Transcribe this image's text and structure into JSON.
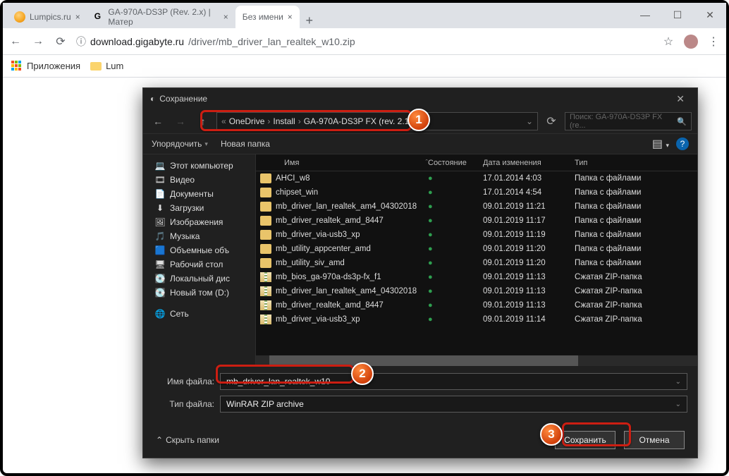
{
  "browser": {
    "tabs": [
      {
        "title": "Lumpics.ru"
      },
      {
        "title": "GA-970A-DS3P (Rev. 2.x) | Матер"
      },
      {
        "title": "Без имени"
      }
    ],
    "url_prefix": "download.gigabyte.ru",
    "url_path": "/driver/mb_driver_lan_realtek_w10.zip",
    "bookmarks_label": "Приложения",
    "bm_folder": "Lum"
  },
  "dialog": {
    "title": "Сохранение",
    "breadcrumb": [
      "OneDrive",
      "Install",
      "GA-970A-DS3P FX (rev. 2.1)"
    ],
    "search_placeholder": "Поиск: GA-970A-DS3P FX (re...",
    "toolbar": {
      "organize": "Упорядочить",
      "newfolder": "Новая папка"
    },
    "tree": [
      {
        "icon": "💻",
        "label": "Этот компьютер",
        "cls": "monitor-ic"
      },
      {
        "icon": "🎞",
        "label": "Видео"
      },
      {
        "icon": "📄",
        "label": "Документы"
      },
      {
        "icon": "⬇",
        "label": "Загрузки"
      },
      {
        "icon": "🖼",
        "label": "Изображения"
      },
      {
        "icon": "🎵",
        "label": "Музыка"
      },
      {
        "icon": "🟦",
        "label": "Объемные объ"
      },
      {
        "icon": "🖥",
        "label": "Рабочий стол"
      },
      {
        "icon": "💽",
        "label": "Локальный дис"
      },
      {
        "icon": "💽",
        "label": "Новый том (D:)"
      },
      {
        "icon": "",
        "label": ""
      },
      {
        "icon": "🌐",
        "label": "Сеть"
      }
    ],
    "columns": {
      "name": "Имя",
      "state": "Состояние",
      "date": "Дата изменения",
      "type": "Тип"
    },
    "files": [
      {
        "kind": "folder",
        "name": "AHCI_w8",
        "date": "17.01.2014 4:03",
        "type": "Папка с файлами"
      },
      {
        "kind": "folder",
        "name": "chipset_win",
        "date": "17.01.2014 4:54",
        "type": "Папка с файлами"
      },
      {
        "kind": "folder",
        "name": "mb_driver_lan_realtek_am4_04302018",
        "date": "09.01.2019 11:21",
        "type": "Папка с файлами"
      },
      {
        "kind": "folder",
        "name": "mb_driver_realtek_amd_8447",
        "date": "09.01.2019 11:17",
        "type": "Папка с файлами"
      },
      {
        "kind": "folder",
        "name": "mb_driver_via-usb3_xp",
        "date": "09.01.2019 11:19",
        "type": "Папка с файлами"
      },
      {
        "kind": "folder",
        "name": "mb_utility_appcenter_amd",
        "date": "09.01.2019 11:20",
        "type": "Папка с файлами"
      },
      {
        "kind": "folder",
        "name": "mb_utility_siv_amd",
        "date": "09.01.2019 11:20",
        "type": "Папка с файлами"
      },
      {
        "kind": "zip",
        "name": "mb_bios_ga-970a-ds3p-fx_f1",
        "date": "09.01.2019 11:13",
        "type": "Сжатая ZIP-папка"
      },
      {
        "kind": "zip",
        "name": "mb_driver_lan_realtek_am4_04302018",
        "date": "09.01.2019 11:13",
        "type": "Сжатая ZIP-папка"
      },
      {
        "kind": "zip",
        "name": "mb_driver_realtek_amd_8447",
        "date": "09.01.2019 11:13",
        "type": "Сжатая ZIP-папка"
      },
      {
        "kind": "zip",
        "name": "mb_driver_via-usb3_xp",
        "date": "09.01.2019 11:14",
        "type": "Сжатая ZIP-папка"
      }
    ],
    "filename_label": "Имя файла:",
    "filename_value": "mb_driver_lan_realtek_w10",
    "filetype_label": "Тип файла:",
    "filetype_value": "WinRAR ZIP archive",
    "hide_folders": "Скрыть папки",
    "save_btn": "Сохранить",
    "cancel_btn": "Отмена"
  },
  "callouts": {
    "c1": "1",
    "c2": "2",
    "c3": "3"
  }
}
